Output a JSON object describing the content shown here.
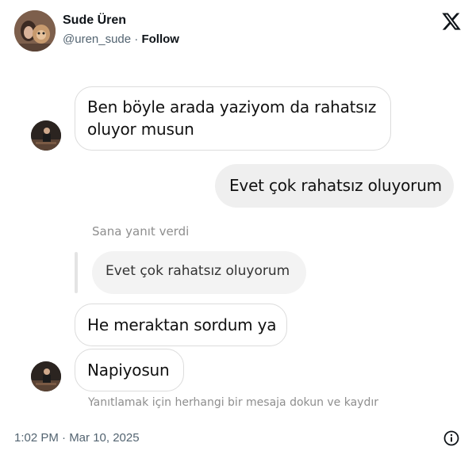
{
  "tweet": {
    "author_name": "Sude Üren",
    "handle": "@uren_sude",
    "separator": "·",
    "follow_label": "Follow",
    "timestamp": "1:02 PM · Mar 10, 2025"
  },
  "chat": {
    "messages": [
      {
        "side": "incoming",
        "lines": [
          "Ben böyle arada yaziyom da rahatsız",
          "oluyor musun"
        ]
      },
      {
        "side": "outgoing",
        "text": "Evet çok rahatsız oluyorum"
      },
      {
        "side": "incoming",
        "text": "He meraktan sordum ya"
      },
      {
        "side": "incoming",
        "text": "Napiyosun"
      }
    ],
    "reply_notice": "Sana yanıt verdi",
    "quoted_text": "Evet çok rahatsız oluyorum",
    "swipe_hint": "Yanıtlamak için herhangi bir mesaja dokun ve kaydır"
  },
  "icons": {
    "brand": "x-logo-icon",
    "info": "info-icon"
  }
}
